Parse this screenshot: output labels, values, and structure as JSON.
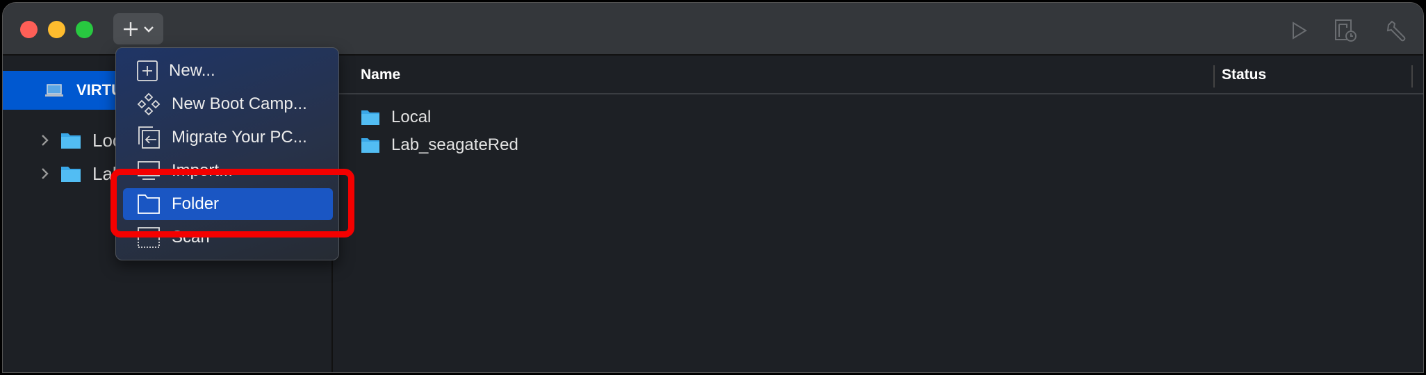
{
  "toolbar": {
    "add_icon": "plus-icon",
    "dropdown_icon": "chevron-down-icon",
    "right_icons": [
      "play-icon",
      "snapshot-clock-icon",
      "wrench-icon"
    ]
  },
  "sidebar": {
    "section_label": "VIRTU",
    "items": [
      {
        "label": "Local"
      },
      {
        "label": "Lab_seagateRed"
      }
    ]
  },
  "main": {
    "columns": [
      "Name",
      "Status"
    ],
    "rows": [
      {
        "name": "Local"
      },
      {
        "name": "Lab_seagateRed"
      }
    ]
  },
  "menu": {
    "items": [
      {
        "label": "New...",
        "icon": "plus-square-icon"
      },
      {
        "label": "New Boot Camp...",
        "icon": "bootcamp-diamonds-icon"
      },
      {
        "label": "Migrate Your PC...",
        "icon": "migrate-icon"
      },
      {
        "label": "Import...",
        "icon": "import-icon"
      },
      {
        "label": "Folder",
        "icon": "folder-outline-icon",
        "highlighted": true
      },
      {
        "label": "Scan",
        "icon": "scan-icon"
      }
    ]
  },
  "colors": {
    "accent": "#0058d0",
    "highlight": "#1a56c3",
    "annotation": "#f40000",
    "folder": "#3aa8e8"
  }
}
